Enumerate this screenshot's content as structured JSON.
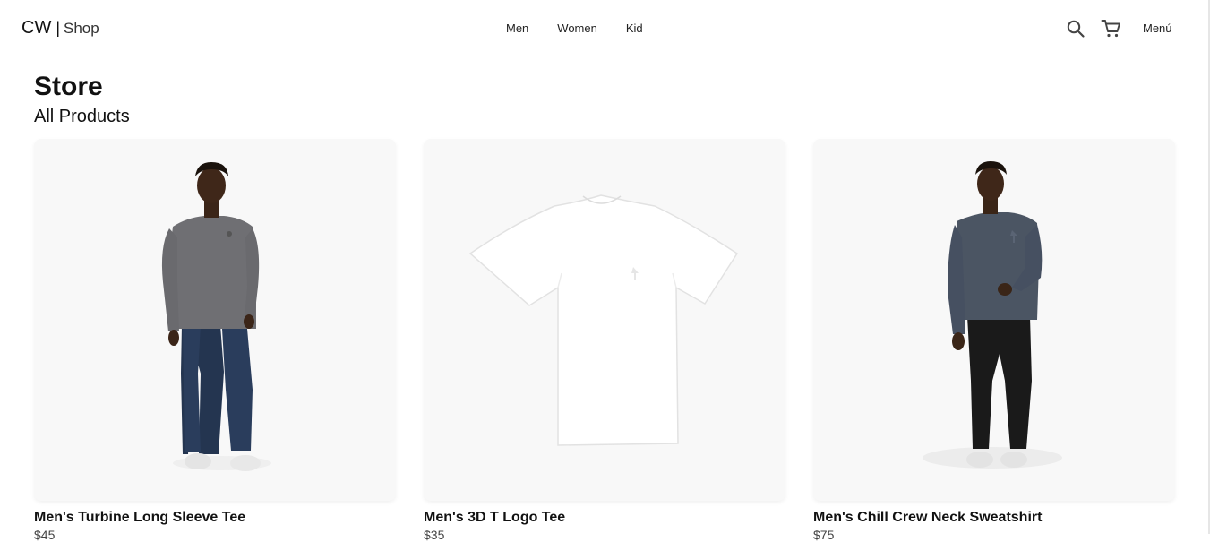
{
  "header": {
    "brand": "CW",
    "separator": "|",
    "shop": "Shop",
    "nav": [
      "Men",
      "Women",
      "Kid"
    ],
    "icons": [
      "search-icon",
      "cart-icon"
    ],
    "menu_label": "Menú"
  },
  "main": {
    "title": "Store",
    "subtitle": "All Products"
  },
  "products": [
    {
      "name": "Men's Turbine Long Sleeve Tee",
      "price": "$45",
      "image": "model-grey-long-sleeve-tee"
    },
    {
      "name": "Men's 3D T Logo Tee",
      "price": "$35",
      "image": "white-tshirt"
    },
    {
      "name": "Men's Chill Crew Neck Sweatshirt",
      "price": "$75",
      "image": "model-slate-sweatshirt"
    }
  ],
  "colors": {
    "background": "#ffffff",
    "card_background": "#f8f8f8",
    "text": "#111111"
  }
}
